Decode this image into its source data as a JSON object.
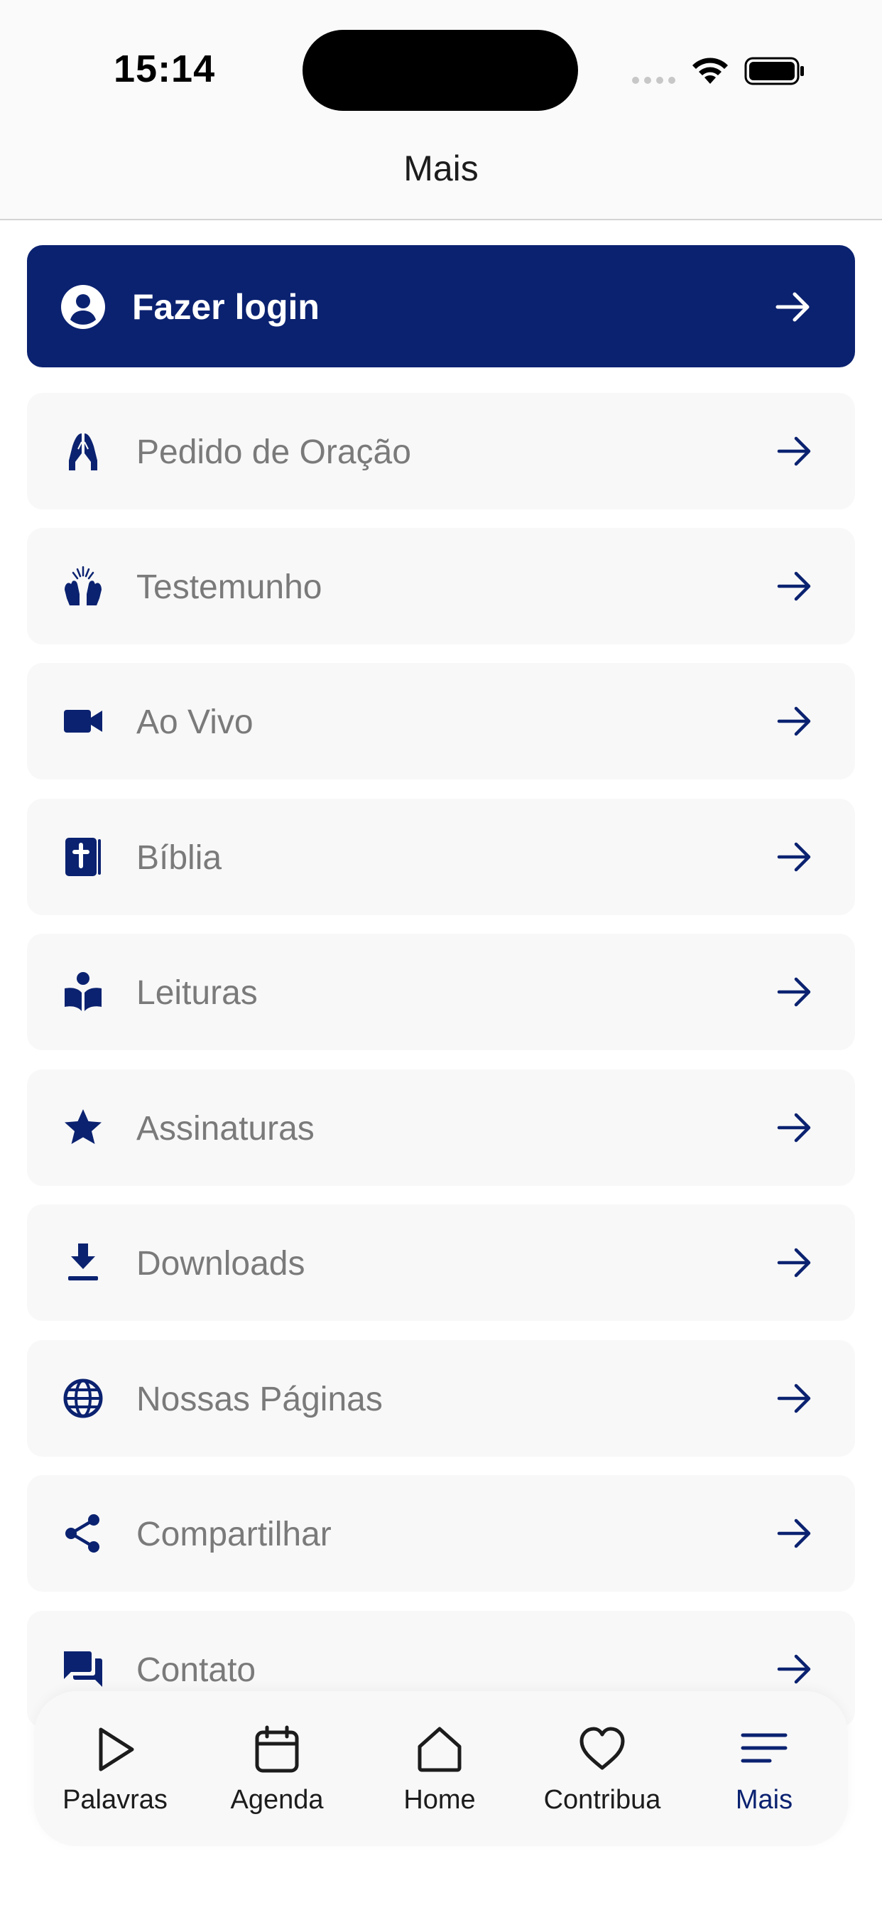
{
  "status_bar": {
    "time": "15:14"
  },
  "header": {
    "title": "Mais"
  },
  "colors": {
    "brand": "#0b2270",
    "item_bg": "#f8f8f8",
    "item_text": "#7a7a7a"
  },
  "login": {
    "label": "Fazer login",
    "icon": "account-circle-icon"
  },
  "menu": {
    "items": [
      {
        "label": "Pedido de Oração",
        "icon": "praying-hands-icon"
      },
      {
        "label": "Testemunho",
        "icon": "raised-hands-icon"
      },
      {
        "label": "Ao Vivo",
        "icon": "video-camera-icon"
      },
      {
        "label": "Bíblia",
        "icon": "bible-icon"
      },
      {
        "label": "Leituras",
        "icon": "reading-person-icon"
      },
      {
        "label": "Assinaturas",
        "icon": "star-icon"
      },
      {
        "label": "Downloads",
        "icon": "download-icon"
      },
      {
        "label": "Nossas Páginas",
        "icon": "globe-icon"
      },
      {
        "label": "Compartilhar",
        "icon": "share-icon"
      },
      {
        "label": "Contato",
        "icon": "chat-icon"
      }
    ]
  },
  "tabs": [
    {
      "label": "Palavras",
      "icon": "play-icon",
      "active": false
    },
    {
      "label": "Agenda",
      "icon": "calendar-icon",
      "active": false
    },
    {
      "label": "Home",
      "icon": "home-icon",
      "active": false
    },
    {
      "label": "Contribua",
      "icon": "heart-icon",
      "active": false
    },
    {
      "label": "Mais",
      "icon": "menu-lines-icon",
      "active": true
    }
  ]
}
